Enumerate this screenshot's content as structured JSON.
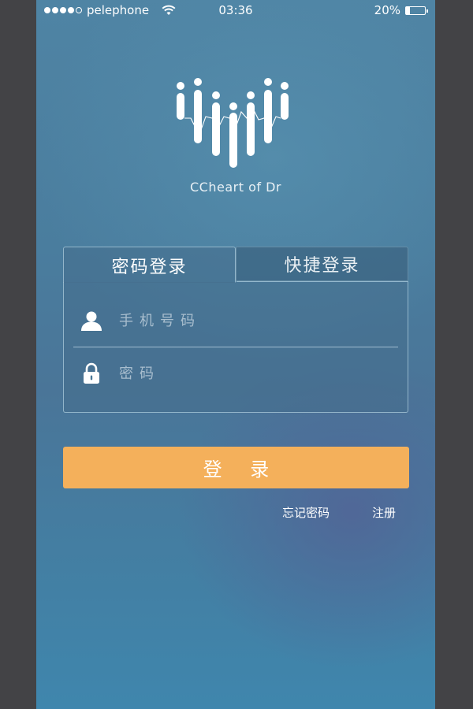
{
  "status_bar": {
    "carrier": "pelephone",
    "time": "03:36",
    "battery_percent": "20%",
    "battery_level": 0.2,
    "signal_bars": 4,
    "signal_total": 5
  },
  "brand": {
    "name": "CCheart of Dr"
  },
  "tabs": [
    {
      "label": "密码登录",
      "active": true
    },
    {
      "label": "快捷登录",
      "active": false
    }
  ],
  "form": {
    "phone_placeholder": "手机号码",
    "phone_value": "",
    "password_placeholder": "密码",
    "password_value": "",
    "user_icon": "user-icon",
    "lock_icon": "lock-icon"
  },
  "actions": {
    "login_label": "登 录",
    "forgot_label": "忘记密码",
    "register_label": "注册"
  },
  "colors": {
    "accent_button": "#f4b05b",
    "background": "#4a7d9e"
  }
}
